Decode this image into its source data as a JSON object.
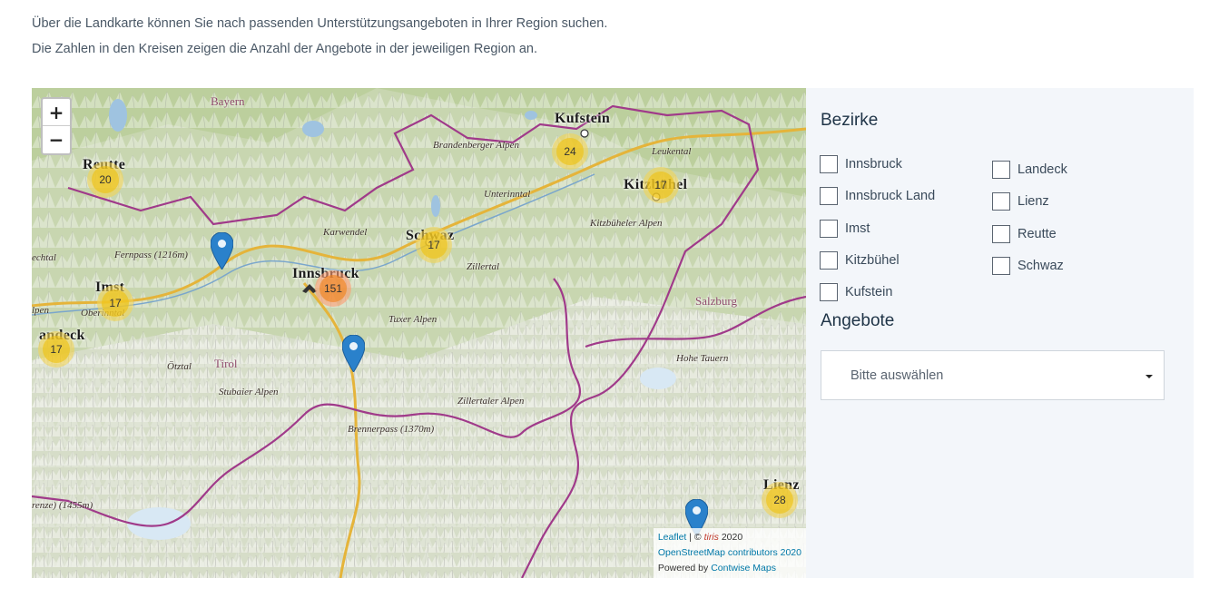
{
  "intro": {
    "line1": "Über die Landkarte können Sie nach passenden Unterstützungsangeboten in Ihrer Region suchen.",
    "line2": "Die Zahlen in den Kreisen zeigen die Anzahl der Angebote in der jeweiligen Region an."
  },
  "map": {
    "zoom_in": "+",
    "zoom_out": "−",
    "clusters": [
      {
        "id": "reutte",
        "count": "20",
        "size": "small"
      },
      {
        "id": "imst",
        "count": "17",
        "size": "small"
      },
      {
        "id": "landeck",
        "count": "17",
        "size": "small"
      },
      {
        "id": "innsbruck",
        "count": "151",
        "size": "medium"
      },
      {
        "id": "schwaz",
        "count": "17",
        "size": "small"
      },
      {
        "id": "kufstein",
        "count": "24",
        "size": "small"
      },
      {
        "id": "kitzbuehel",
        "count": "17",
        "size": "small"
      },
      {
        "id": "lienz",
        "count": "28",
        "size": "small"
      }
    ],
    "labels": {
      "bayern": "Bayern",
      "kufstein": "Kufstein",
      "reutte": "Reutte",
      "kitzbuehel": "Kitzbühel",
      "schwaz": "Schwaz",
      "innsbruck": "Innsbruck",
      "imst": "Imst",
      "landeck": "andeck",
      "lienz": "Lienz",
      "brandenberger": "Brandenberger Alpen",
      "leukental": "Leukental",
      "unterinntal": "Unterinntal",
      "kitzbueheler_alpen": "Kitzbüheler Alpen",
      "karwendel": "Karwendel",
      "fernpass": "Fernpass (1216m)",
      "zillertal": "Zillertal",
      "salzburg": "Salzburg",
      "oberinntal": "Oberinntal",
      "tuxer": "Tuxer Alpen",
      "hohe_tauern": "Hohe Tauern",
      "oetztal": "Ötztal",
      "tirol": "Tirol",
      "stubaier": "Stubaier Alpen",
      "zillertaler": "Zillertaler Alpen",
      "brennerpass": "Brennerpass (1370m)",
      "echtal": "echtal",
      "lpen": "lpen",
      "grenze": "renze) (1455m)"
    },
    "attribution": {
      "leaflet": "Leaflet",
      "sep1": " | © ",
      "tiris": "tiris",
      "year": " 2020",
      "osm": "OpenStreetMap contributors 2020",
      "powered": "Powered by ",
      "contwise": "Contwise Maps"
    }
  },
  "panel": {
    "bezirke_title": "Bezirke",
    "bezirke": [
      "Innsbruck",
      "Innsbruck Land",
      "Imst",
      "Kitzbühel",
      "Kufstein",
      "Landeck",
      "Lienz",
      "Reutte",
      "Schwaz"
    ],
    "angebote_title": "Angebote",
    "angebote_placeholder": "Bitte auswählen"
  },
  "colors": {
    "panel_bg": "#f3f6fa",
    "cluster_small": "#f0c20c",
    "cluster_medium": "#f18017",
    "marker": "#2a81cb",
    "border": "#a03a8a"
  }
}
